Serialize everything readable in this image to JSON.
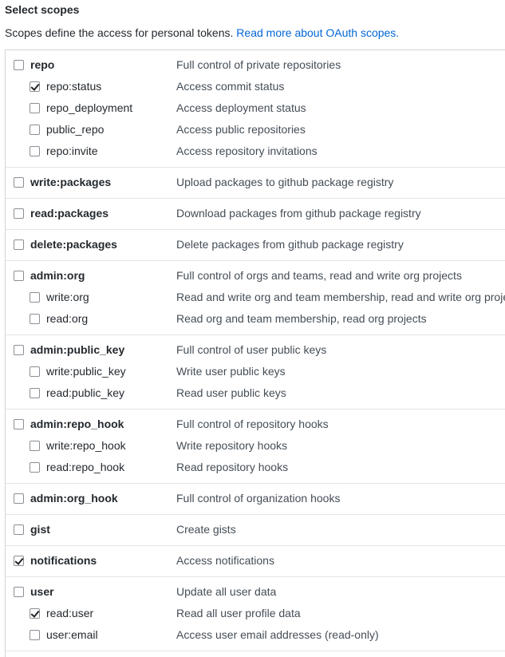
{
  "header": {
    "title": "Select scopes",
    "description": "Scopes define the access for personal tokens.",
    "link_text": "Read more about OAuth scopes."
  },
  "groups": [
    {
      "name": "repo",
      "desc": "Full control of private repositories",
      "checked": false,
      "children": [
        {
          "name": "repo:status",
          "desc": "Access commit status",
          "checked": true
        },
        {
          "name": "repo_deployment",
          "desc": "Access deployment status",
          "checked": false
        },
        {
          "name": "public_repo",
          "desc": "Access public repositories",
          "checked": false
        },
        {
          "name": "repo:invite",
          "desc": "Access repository invitations",
          "checked": false
        }
      ]
    },
    {
      "name": "write:packages",
      "desc": "Upload packages to github package registry",
      "checked": false,
      "children": []
    },
    {
      "name": "read:packages",
      "desc": "Download packages from github package registry",
      "checked": false,
      "children": []
    },
    {
      "name": "delete:packages",
      "desc": "Delete packages from github package registry",
      "checked": false,
      "children": []
    },
    {
      "name": "admin:org",
      "desc": "Full control of orgs and teams, read and write org projects",
      "checked": false,
      "children": [
        {
          "name": "write:org",
          "desc": "Read and write org and team membership, read and write org projects",
          "checked": false
        },
        {
          "name": "read:org",
          "desc": "Read org and team membership, read org projects",
          "checked": false
        }
      ]
    },
    {
      "name": "admin:public_key",
      "desc": "Full control of user public keys",
      "checked": false,
      "children": [
        {
          "name": "write:public_key",
          "desc": "Write user public keys",
          "checked": false
        },
        {
          "name": "read:public_key",
          "desc": "Read user public keys",
          "checked": false
        }
      ]
    },
    {
      "name": "admin:repo_hook",
      "desc": "Full control of repository hooks",
      "checked": false,
      "children": [
        {
          "name": "write:repo_hook",
          "desc": "Write repository hooks",
          "checked": false
        },
        {
          "name": "read:repo_hook",
          "desc": "Read repository hooks",
          "checked": false
        }
      ]
    },
    {
      "name": "admin:org_hook",
      "desc": "Full control of organization hooks",
      "checked": false,
      "children": []
    },
    {
      "name": "gist",
      "desc": "Create gists",
      "checked": false,
      "children": []
    },
    {
      "name": "notifications",
      "desc": "Access notifications",
      "checked": true,
      "children": []
    },
    {
      "name": "user",
      "desc": "Update all user data",
      "checked": false,
      "children": [
        {
          "name": "read:user",
          "desc": "Read all user profile data",
          "checked": true
        },
        {
          "name": "user:email",
          "desc": "Access user email addresses (read-only)",
          "checked": false
        }
      ]
    }
  ]
}
